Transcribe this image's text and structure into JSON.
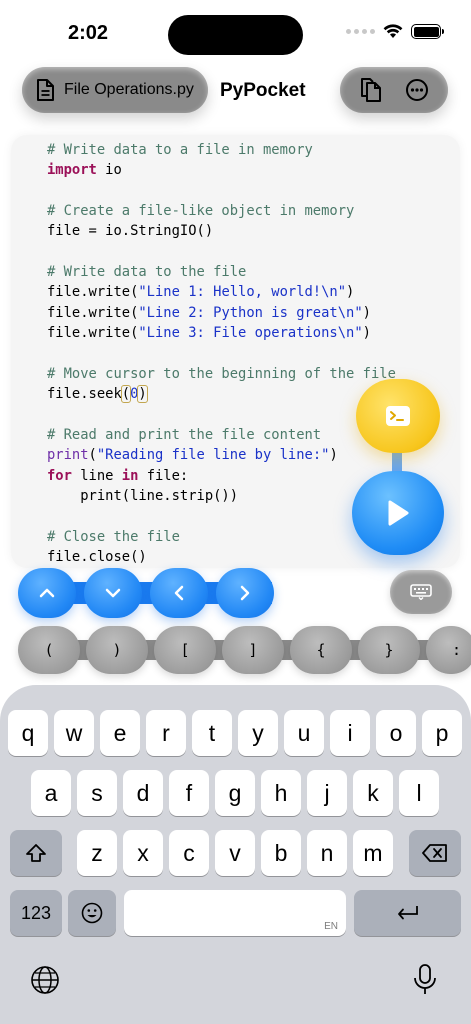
{
  "status_bar": {
    "time": "2:02"
  },
  "toolbar": {
    "file_name": "File Operations.py",
    "app_title": "PyPocket",
    "icons": [
      "document-icon",
      "copy-icon",
      "more-icon"
    ]
  },
  "editor": {
    "lines": [
      [
        {
          "t": "# Write data to a file in memory",
          "c": "comment"
        }
      ],
      [
        {
          "t": "import",
          "c": "kw"
        },
        {
          "t": " io",
          "c": ""
        }
      ],
      [],
      [
        {
          "t": "# Create a file-like object in memory",
          "c": "comment"
        }
      ],
      [
        {
          "t": "file = io.StringIO()",
          "c": ""
        }
      ],
      [],
      [
        {
          "t": "# Write data to the file",
          "c": "comment"
        }
      ],
      [
        {
          "t": "file.write(",
          "c": ""
        },
        {
          "t": "\"Line 1: Hello, world!\\n\"",
          "c": "str"
        },
        {
          "t": ")",
          "c": ""
        }
      ],
      [
        {
          "t": "file.write(",
          "c": ""
        },
        {
          "t": "\"Line 2: Python is great\\n\"",
          "c": "str"
        },
        {
          "t": ")",
          "c": ""
        }
      ],
      [
        {
          "t": "file.write(",
          "c": ""
        },
        {
          "t": "\"Line 3: File operations\\n\"",
          "c": "str"
        },
        {
          "t": ")",
          "c": ""
        }
      ],
      [],
      [
        {
          "t": "# Move cursor to the beginning of the file",
          "c": "comment"
        }
      ],
      [
        {
          "t": "file.seek",
          "c": ""
        },
        {
          "t": "(",
          "c": "cursor"
        },
        {
          "t": "0",
          "c": "num"
        },
        {
          "t": ")",
          "c": "cursor"
        }
      ],
      [],
      [
        {
          "t": "# Read and print the file content",
          "c": "comment"
        }
      ],
      [
        {
          "t": "print",
          "c": "fn"
        },
        {
          "t": "(",
          "c": ""
        },
        {
          "t": "\"Reading file line by line:\"",
          "c": "str"
        },
        {
          "t": ")",
          "c": ""
        }
      ],
      [
        {
          "t": "for",
          "c": "kw"
        },
        {
          "t": " line ",
          "c": ""
        },
        {
          "t": "in",
          "c": "kw"
        },
        {
          "t": " file:",
          "c": ""
        }
      ],
      [
        {
          "t": "    print(line.strip())",
          "c": ""
        }
      ],
      [],
      [
        {
          "t": "# Close the file",
          "c": "comment"
        }
      ],
      [
        {
          "t": "file.close()",
          "c": ""
        }
      ]
    ]
  },
  "floating_buttons": {
    "terminal_icon": "terminal-icon",
    "run_icon": "play-icon"
  },
  "arrow_keys": [
    "chevron-up-icon",
    "chevron-down-icon",
    "chevron-left-icon",
    "chevron-right-icon"
  ],
  "keyboard_toggle_icon": "keyboard-icon",
  "symbol_keys": [
    "(",
    ")",
    "[",
    "]",
    "{",
    "}",
    ":"
  ],
  "keyboard": {
    "row1": [
      "q",
      "w",
      "e",
      "r",
      "t",
      "y",
      "u",
      "i",
      "o",
      "p"
    ],
    "row2": [
      "a",
      "s",
      "d",
      "f",
      "g",
      "h",
      "j",
      "k",
      "l"
    ],
    "row3": [
      "z",
      "x",
      "c",
      "v",
      "b",
      "n",
      "m"
    ],
    "numbers_label": "123",
    "space_lang": "EN"
  },
  "colors": {
    "accent_blue": "#1f8cf5",
    "accent_yellow": "#f7c61d",
    "comment": "#4c7a6a",
    "keyword": "#9b1058",
    "string": "#1a32c8"
  }
}
